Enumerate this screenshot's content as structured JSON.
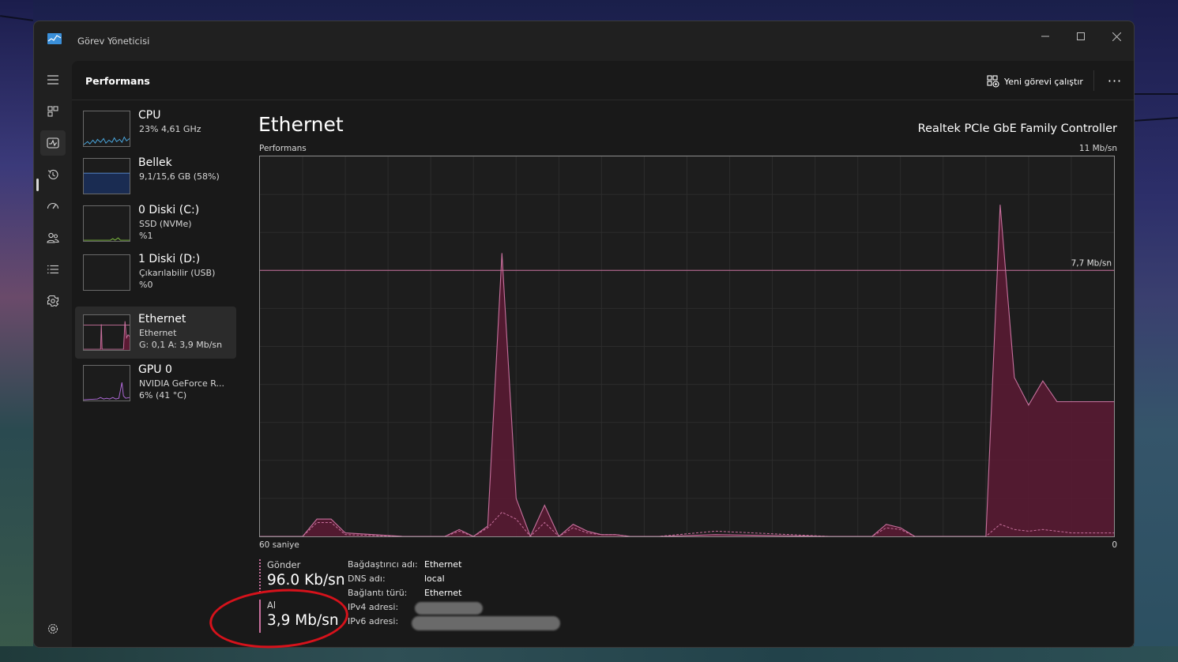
{
  "window": {
    "title": "Görev Yöneticisi"
  },
  "header": {
    "page_title": "Performans",
    "run_task_label": "Yeni görevi çalıştır",
    "more_label": "···"
  },
  "nav": [
    {
      "name": "hamburger-menu-icon"
    },
    {
      "name": "processes-icon"
    },
    {
      "name": "performance-icon"
    },
    {
      "name": "app-history-icon"
    },
    {
      "name": "startup-apps-icon"
    },
    {
      "name": "users-icon"
    },
    {
      "name": "details-icon"
    },
    {
      "name": "services-icon"
    },
    {
      "name": "settings-icon"
    }
  ],
  "devices": [
    {
      "name": "CPU",
      "sub1": "23% 4,61 GHz",
      "sub2": ""
    },
    {
      "name": "Bellek",
      "sub1": "9,1/15,6 GB (58%)",
      "sub2": ""
    },
    {
      "name": "0 Diski (C:)",
      "sub1": "SSD (NVMe)",
      "sub2": "%1"
    },
    {
      "name": "1 Diski (D:)",
      "sub1": "Çıkarılabilir (USB)",
      "sub2": "%0"
    },
    {
      "name": "Ethernet",
      "sub1": "Ethernet",
      "sub2": "G: 0,1 A: 3,9 Mb/sn"
    },
    {
      "name": "GPU 0",
      "sub1": "NVIDIA GeForce R...",
      "sub2": "6% (41 °C)"
    }
  ],
  "main": {
    "title": "Ethernet",
    "adapter": "Realtek PCIe GbE Family Controller",
    "perf_label": "Performans",
    "max_label": "11 Mb/sn",
    "line_label": "7,7 Mb/sn",
    "axis_left": "60 saniye",
    "axis_right": "0"
  },
  "stats": {
    "send_label": "Gönder",
    "send_value": "96.0 Kb/sn",
    "recv_label": "Al",
    "recv_value": "3,9 Mb/sn"
  },
  "info": [
    {
      "key": "Bağdaştırıcı adı:",
      "value": "Ethernet"
    },
    {
      "key": "DNS adı:",
      "value": "local"
    },
    {
      "key": "Bağlantı türü:",
      "value": "Ethernet"
    },
    {
      "key": "IPv4 adresi:",
      "value": ""
    },
    {
      "key": "IPv6 adresi:",
      "value": ""
    }
  ],
  "colors": {
    "accent": "#c7709d",
    "graph_fill": "#5c1a34",
    "window_bg": "#202020",
    "annotation": "#d6121b"
  },
  "chart_data": {
    "type": "area",
    "title": "",
    "xlabel": "60 saniye",
    "ylabel": "",
    "xlim": [
      60,
      0
    ],
    "ylim": [
      0,
      11
    ],
    "reference_line": 7.7,
    "x": [
      60,
      58,
      57,
      56,
      55,
      54,
      50,
      48,
      47,
      46,
      45,
      44,
      43,
      42,
      41,
      40,
      39,
      38,
      37,
      36,
      35,
      34,
      33,
      32,
      28,
      20,
      18,
      17,
      16,
      15,
      14,
      13,
      12,
      11,
      10,
      9,
      8,
      7,
      6,
      5,
      4,
      3,
      2,
      1,
      0
    ],
    "series": [
      {
        "name": "Al",
        "values": [
          0,
          0,
          0,
          0.5,
          0.5,
          0.1,
          0,
          0,
          0,
          0.2,
          0,
          0.3,
          8.2,
          1.1,
          0,
          0.9,
          0,
          0.35,
          0.15,
          0.05,
          0.05,
          0,
          0,
          0,
          0.05,
          0,
          0,
          0,
          0.35,
          0.25,
          0,
          0,
          0,
          0,
          0,
          0,
          9.6,
          4.6,
          3.8,
          4.5,
          3.9,
          3.9,
          3.9,
          3.9,
          3.9
        ]
      },
      {
        "name": "Gönder",
        "values": [
          0,
          0,
          0,
          0.4,
          0.4,
          0.05,
          0,
          0,
          0,
          0.15,
          0,
          0.25,
          0.7,
          0.5,
          0,
          0.4,
          0,
          0.25,
          0.1,
          0.05,
          0.05,
          0,
          0,
          0,
          0.15,
          0,
          0,
          0,
          0.25,
          0.2,
          0,
          0,
          0,
          0,
          0,
          0,
          0.35,
          0.2,
          0.15,
          0.2,
          0.15,
          0.1,
          0.1,
          0.1,
          0.1
        ]
      }
    ]
  }
}
